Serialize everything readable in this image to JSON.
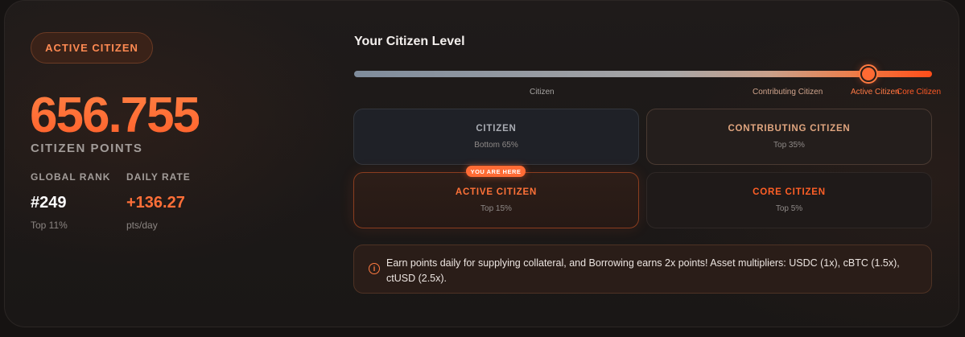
{
  "status": {
    "label": "ACTIVE CITIZEN"
  },
  "points": {
    "value": "656.755",
    "label": "CITIZEN POINTS"
  },
  "stats": {
    "rank": {
      "label": "GLOBAL RANK",
      "value": "#249",
      "sub": "Top 11%"
    },
    "rate": {
      "label": "DAILY RATE",
      "value": "+136.27",
      "sub": "pts/day"
    }
  },
  "level": {
    "title": "Your Citizen Level",
    "ticks": {
      "citizen": "Citizen",
      "contributing": "Contributing Citizen",
      "active": "Active Citizen",
      "core": "Core Citizen"
    }
  },
  "tiers": {
    "citizen": {
      "name": "CITIZEN",
      "range": "Bottom 65%"
    },
    "contributing": {
      "name": "CONTRIBUTING CITIZEN",
      "range": "Top 35%"
    },
    "active": {
      "name": "ACTIVE CITIZEN",
      "range": "Top 15%",
      "badge": "YOU ARE HERE"
    },
    "core": {
      "name": "CORE CITIZEN",
      "range": "Top 5%"
    }
  },
  "info": {
    "icon": "info-icon",
    "icon_glyph": "i",
    "text": "Earn points daily for supplying collateral, and Borrowing earns 2x points! Asset multipliers: USDC (1x), cBTC (1.5x), ctUSD (2.5x)."
  },
  "colors": {
    "accent": "#ff6a33",
    "background": "#1a1716"
  }
}
